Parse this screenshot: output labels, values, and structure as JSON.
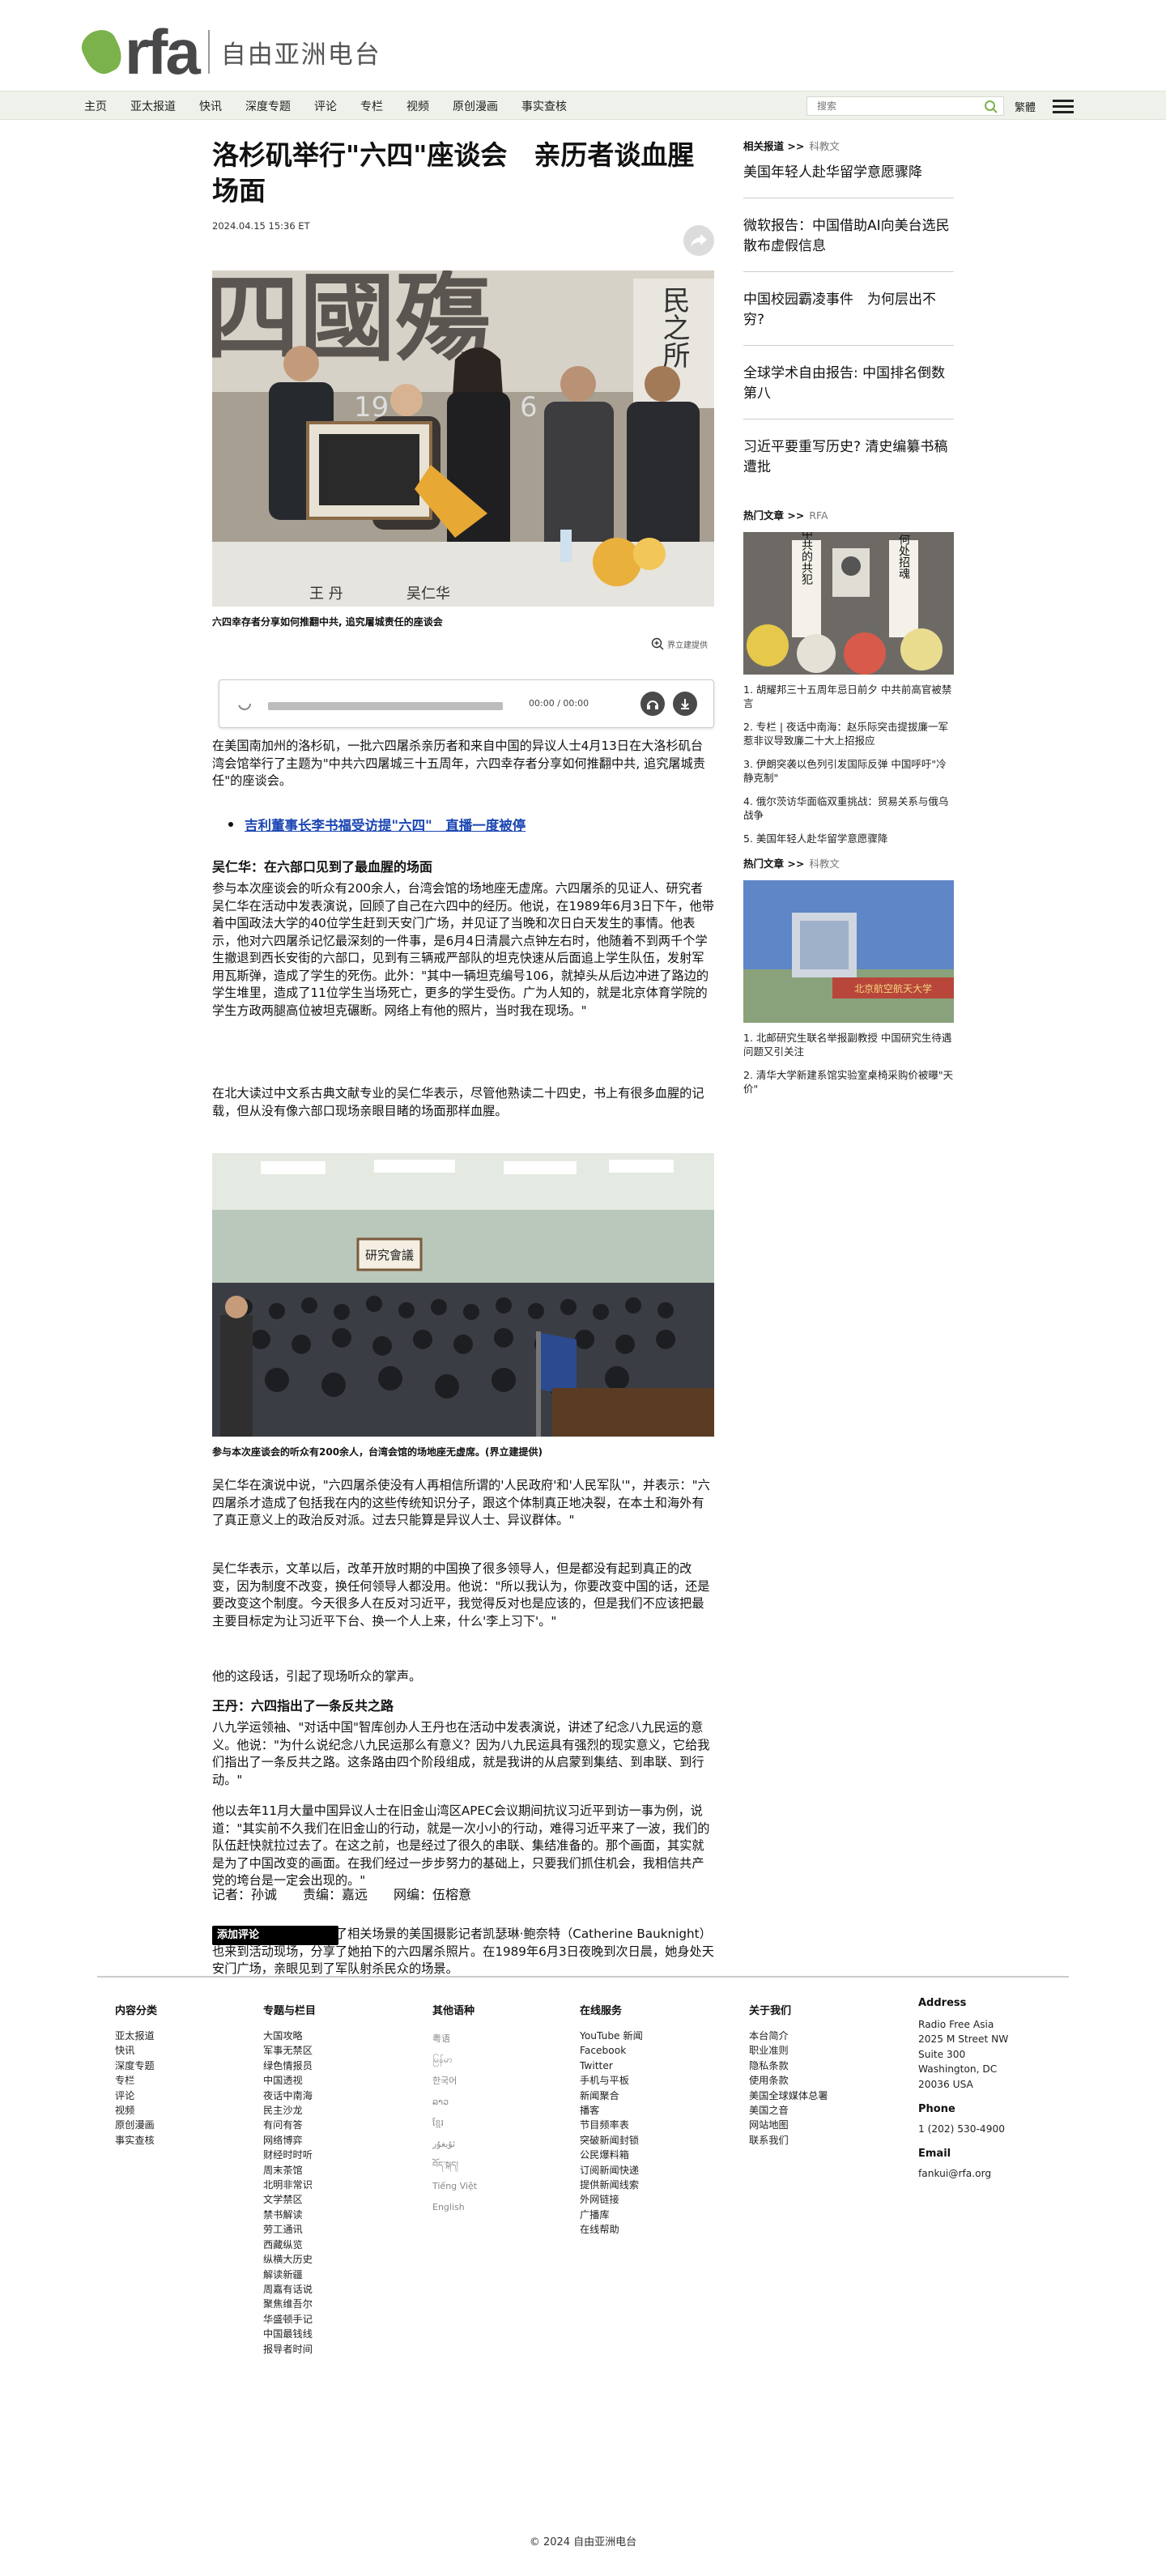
{
  "logo": {
    "brand": "rfa",
    "cn": "自由亚洲电台"
  },
  "nav": {
    "items": [
      "主页",
      "亚太报道",
      "快讯",
      "深度专题",
      "评论",
      "专栏",
      "视频",
      "原创漫画",
      "事实查核"
    ],
    "search_placeholder": "搜索",
    "lang": "繁體"
  },
  "article": {
    "headline": "洛杉矶举行\"六四\"座谈会　亲历者谈血腥场面",
    "date": "2024.04.15 15:36 ET",
    "caption1": "六四幸存者分享如何推翻中共, 追究屠城责任的座谈会",
    "credit1": "界立建提供",
    "audio_time": "00:00 / 00:00",
    "p1": "在美国南加州的洛杉矶，一批六四屠杀亲历者和来自中国的异议人士4月13日在大洛杉矶台湾会馆举行了主题为\"中共六四屠城三十五周年，六四幸存者分享如何推翻中共, 追究屠城责任\"的座谈会。",
    "bullet": "吉利董事长李书福受访提\"六四\"　直播一度被停",
    "sub1": "吴仁华：在六部口见到了最血腥的场面",
    "p2": "参与本次座谈会的听众有200余人，台湾会馆的场地座无虚席。六四屠杀的见证人、研究者吴仁华在活动中发表演说，回顾了自己在六四中的经历。他说，在1989年6月3日下午，他带着中国政法大学的40位学生赶到天安门广场，并见证了当晚和次日白天发生的事情。他表示，他对六四屠杀记忆最深刻的一件事，是6月4日清晨六点钟左右时，他随着不到两千个学生撤退到西长安街的六部口，见到有三辆戒严部队的坦克快速从后面追上学生队伍，发射军用瓦斯弹，造成了学生的死伤。此外：\"其中一辆坦克编号106，就掉头从后边冲进了路边的学生堆里，造成了11位学生当场死亡，更多的学生受伤。广为人知的，就是北京体育学院的学生方政两腿高位被坦克碾断。网络上有他的照片，当时我在现场。\"",
    "p3": "在北大读过中文系古典文献专业的吴仁华表示，尽管他熟读二十四史，书上有很多血腥的记载，但从没有像六部口现场亲眼目睹的场面那样血腥。",
    "caption2": "参与本次座谈会的听众有200余人，台湾会馆的场地座无虚席。(界立建提供)",
    "p4": "吴仁华在演说中说，\"六四屠杀使没有人再相信所谓的'人民政府'和'人民军队'\"，并表示：\"六四屠杀才造成了包括我在内的这些传统知识分子，跟这个体制真正地决裂，在本土和海外有了真正意义上的政治反对派。过去只能算是异议人士、异议群体。\"",
    "p5": "吴仁华表示，文革以后，改革开放时期的中国换了很多领导人，但是都没有起到真正的改变，因为制度不改变，换任何领导人都没用。他说：\"所以我认为，你要改变中国的话，还是要改变这个制度。今天很多人在反对习近平，我觉得反对也是应该的，但是我们不应该把最主要目标定为让习近平下台、换一个人上来，什么'李上习下'。\"",
    "p6": "他的这段话，引起了现场听众的掌声。",
    "sub2": "王丹：六四指出了一条反共之路",
    "p7": "八九学运领袖、\"对话中国\"智库创办人王丹也在活动中发表演说，讲述了纪念八九民运的意义。他说：\"为什么说纪念八九民运那么有意义？因为八九民运具有强烈的现实意义，它给我们指出了一条反共之路。这条路由四个阶段组成，就是我讲的从启蒙到集结、到串联、到行动。\"",
    "p8": "他以去年11月大量中国异议人士在旧金山湾区APEC会议期间抗议习近平到访一事为例，说道：\"其实前不久我们在旧金山的行动，就是一次小小的行动，难得习近平来了一波，我们的队伍赶快就拉过去了。在这之前，也是经过了很久的串联、集结准备的。那个画面，其实就是为了中国改变的画面。在我们经过一步步努力的基础上，只要我们抓住机会，我相信共产党的垮台是一定会出现的。\"",
    "p9": "在六四屠杀期间记录下了相关场景的美国摄影记者凯瑟琳·鲍奈特（Catherine Bauknight）也来到活动现场，分享了她拍下的六四屠杀照片。在1989年6月3日夜晚到次日晨，她身处天安门广场，亲眼见到了军队射杀民众的场景。",
    "byline": "记者：孙诚　　责编：嘉远　　网编：伍榕意",
    "comment_btn": "添加评论",
    "photo1_banner": "四國殤",
    "photo1_side": "民之所",
    "photo1_number": "19",
    "photo1_number2": "6",
    "photo1_name1": "王 丹",
    "photo1_name2": "吴仁华",
    "photo2_sign": "研究會議"
  },
  "sidebar": {
    "related_label": "相关报道 >>",
    "related_sub": "科教文",
    "related": [
      "美国年轻人赴华留学意愿骤降",
      "微软报告：中国借助AI向美台选民散布虚假信息",
      "中国校园霸凌事件　为何层出不穷?",
      "全球学术自由报告: 中国排名倒数第八",
      "习近平要重写历史? 清史编纂书稿遭批"
    ],
    "hot1_label": "热门文章 >>",
    "hot1_sub": "RFA",
    "hot1_img_text": [
      "中共的共犯",
      "何处招魂"
    ],
    "hot1": [
      "1. 胡耀邦三十五周年忌日前夕 中共前高官被禁言",
      "2. 专栏 | 夜话中南海：赵乐际突击提拔廉一军惹非议导致廉二十大上招报应",
      "3. 伊朗突袭以色列引发国际反弹 中国呼吁\"冷静克制\"",
      "4. 俄尔茨访华面临双重挑战：贸易关系与俄乌战争",
      "5. 美国年轻人赴华留学意愿骤降"
    ],
    "hot2_label": "热门文章 >>",
    "hot2_sub": "科教文",
    "hot2_img_text": "北京航空航天大学",
    "hot2": [
      "1. 北邮研究生联名举报副教授 中国研究生待遇问题又引关注",
      "2. 清华大学新建系馆实验室桌椅采购价被曝\"天价\""
    ]
  },
  "footer": {
    "col1": {
      "title": "内容分类",
      "items": [
        "亚太报道",
        "快讯",
        "深度专题",
        "专栏",
        "评论",
        "视频",
        "原创漫画",
        "事实查核"
      ]
    },
    "col2": {
      "title": "专题与栏目",
      "items": [
        "大国攻略",
        "军事无禁区",
        "绿色情报员",
        "中国透视",
        "夜话中南海",
        "民主沙龙",
        "有问有答",
        "网络博弈",
        "财经时时听",
        "周末茶馆",
        "北明非常识",
        "文学禁区",
        "禁书解读",
        "劳工通讯",
        "西藏纵览",
        "纵横大历史",
        "解读新疆",
        "周嘉有话说",
        "聚焦维吾尔",
        "华盛顿手记",
        "中国最钱线",
        "报导者时间"
      ]
    },
    "col3": {
      "title": "其他语种",
      "items": [
        "粤语",
        "မြန်မာ",
        "한국어",
        "ລາວ",
        "ខ្មែរ",
        "ئۇيغۇر",
        "བོད་སྐད།",
        "Tiếng Việt",
        "English"
      ]
    },
    "col4": {
      "title": "在线服务",
      "items": [
        "YouTube 新闻",
        "Facebook",
        "Twitter",
        "手机与平板",
        "新闻聚合",
        "播客",
        "节目频率表",
        "突破新闻封锁",
        "公民爆料箱",
        "订阅新闻快递",
        "提供新闻线索",
        "外网链接",
        "广播库",
        "在线帮助"
      ]
    },
    "col5": {
      "title": "关于我们",
      "items": [
        "本台简介",
        "职业准则",
        "隐私条款",
        "使用条款",
        "美国全球媒体总署",
        "美国之音",
        "网站地图",
        "联系我们"
      ]
    },
    "col6": {
      "title": "Address",
      "address": [
        "Radio Free Asia",
        "2025 M Street NW",
        "Suite 300",
        "Washington, DC",
        "20036 USA"
      ],
      "phone_label": "Phone",
      "phone": "1 (202) 530-4900",
      "email_label": "Email",
      "email": "fankui@rfa.org"
    },
    "copyright": "© 2024 自由亚洲电台"
  },
  "colors": {
    "brand_green": "#7bb24b",
    "nav_bg": "#eef2ea",
    "link_blue": "#1b46b3"
  }
}
